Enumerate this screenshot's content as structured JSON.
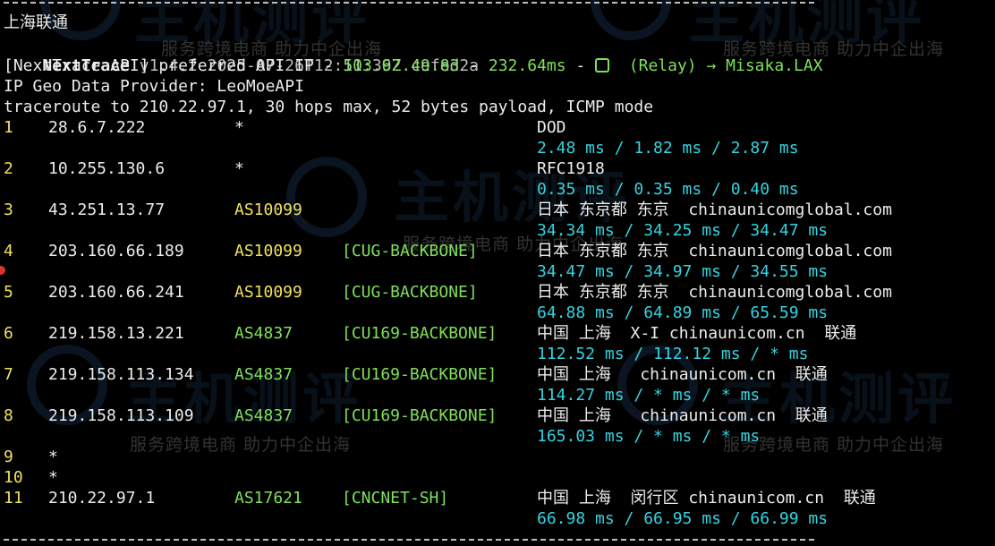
{
  "header": {
    "isp_title": "上海联通",
    "version_label": "NextTrace",
    "version_info": "v1.4.2 2025-07-26T12:51:39Z cefed2a",
    "api_prefix": "[NextTrace API] preferred API IP - ",
    "api_ip": "103.62.49.83",
    "api_dash1": " - ",
    "api_latency": "232.64ms",
    "api_dash2": " - ",
    "api_relay": "(Relay)",
    "api_arrow": " → ",
    "api_node": "Misaka.LAX",
    "geo_provider": "IP Geo Data Provider: LeoMoeAPI",
    "traceroute": "traceroute to 210.22.97.1, 30 hops max, 52 bytes payload, ICMP mode"
  },
  "watermark": {
    "brand": "主机测评",
    "slogan": "服务跨境电商 助力中企出海"
  },
  "hops": [
    {
      "n": "1",
      "ip": "28.6.7.222",
      "asn": "*",
      "tag": "",
      "geo": "DOD",
      "rtt": "2.48 ms / 1.82 ms / 2.87 ms"
    },
    {
      "n": "2",
      "ip": "10.255.130.6",
      "asn": "*",
      "tag": "",
      "geo": "RFC1918",
      "rtt": "0.35 ms / 0.35 ms / 0.40 ms"
    },
    {
      "n": "3",
      "ip": "43.251.13.77",
      "asn": "AS10099",
      "tag": "",
      "geo": "日本 东京都 东京  chinaunicomglobal.com",
      "rtt": "34.34 ms / 34.25 ms / 34.47 ms"
    },
    {
      "n": "4",
      "ip": "203.160.66.189",
      "asn": "AS10099",
      "tag": "[CUG-BACKBONE]",
      "geo": "日本 东京都 东京  chinaunicomglobal.com",
      "rtt": "34.47 ms / 34.97 ms / 34.55 ms"
    },
    {
      "n": "5",
      "ip": "203.160.66.241",
      "asn": "AS10099",
      "tag": "[CUG-BACKBONE]",
      "geo": "日本 东京都 东京  chinaunicomglobal.com",
      "rtt": "64.88 ms / 64.89 ms / 65.59 ms"
    },
    {
      "n": "6",
      "ip": "219.158.13.221",
      "asn": "AS4837",
      "tag": "[CU169-BACKBONE]",
      "geo": "中国 上海  X-I chinaunicom.cn  联通",
      "rtt": "112.52 ms / 112.12 ms / * ms"
    },
    {
      "n": "7",
      "ip": "219.158.113.134",
      "asn": "AS4837",
      "tag": "[CU169-BACKBONE]",
      "geo": "中国 上海   chinaunicom.cn  联通",
      "rtt": "114.27 ms / * ms / * ms"
    },
    {
      "n": "8",
      "ip": "219.158.113.109",
      "asn": "AS4837",
      "tag": "[CU169-BACKBONE]",
      "geo": "中国 上海   chinaunicom.cn  联通",
      "rtt": "165.03 ms / * ms / * ms"
    },
    {
      "n": "9",
      "ip": "*",
      "asn": "",
      "tag": "",
      "geo": "",
      "rtt": ""
    },
    {
      "n": "10",
      "ip": "*",
      "asn": "",
      "tag": "",
      "geo": "",
      "rtt": ""
    },
    {
      "n": "11",
      "ip": "210.22.97.1",
      "asn": "AS17621",
      "tag": "[CNCNET-SH]",
      "geo": "中国 上海  闵行区 chinaunicom.cn  联通",
      "rtt": "66.98 ms / 66.95 ms / 66.99 ms"
    }
  ],
  "colors": {
    "background": "#000000",
    "ip_highlight": "#7fe05a",
    "rtt": "#35d3e0",
    "hop_number": "#f0e25a",
    "asn": "#f0e25a",
    "tag": "#7fe05a"
  }
}
